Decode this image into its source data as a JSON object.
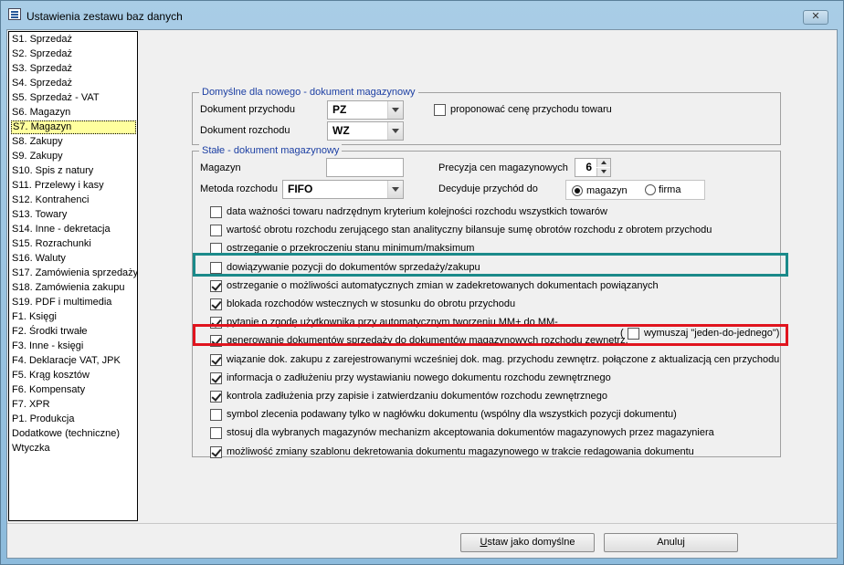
{
  "window": {
    "title": "Ustawienia zestawu baz danych",
    "close_symbol": "✕"
  },
  "nav": {
    "items": [
      {
        "label": "S1. Sprzedaż"
      },
      {
        "label": "S2. Sprzedaż"
      },
      {
        "label": "S3. Sprzedaż"
      },
      {
        "label": "S4. Sprzedaż"
      },
      {
        "label": "S5. Sprzedaż - VAT"
      },
      {
        "label": "S6. Magazyn"
      },
      {
        "label": "S7. Magazyn",
        "selected": true
      },
      {
        "label": "S8. Zakupy"
      },
      {
        "label": "S9. Zakupy"
      },
      {
        "label": "S10. Spis z natury"
      },
      {
        "label": "S11. Przelewy i kasy"
      },
      {
        "label": "S12. Kontrahenci"
      },
      {
        "label": "S13. Towary"
      },
      {
        "label": "S14. Inne - dekretacja"
      },
      {
        "label": "S15. Rozrachunki"
      },
      {
        "label": "S16. Waluty"
      },
      {
        "label": "S17. Zamówienia sprzedaży"
      },
      {
        "label": "S18. Zamówienia zakupu"
      },
      {
        "label": "S19. PDF i multimedia"
      },
      {
        "label": "F1. Księgi"
      },
      {
        "label": "F2. Środki trwałe"
      },
      {
        "label": "F3. Inne - księgi"
      },
      {
        "label": "F4. Deklaracje VAT, JPK"
      },
      {
        "label": "F5. Krąg kosztów"
      },
      {
        "label": "F6. Kompensaty"
      },
      {
        "label": "F7. XPR"
      },
      {
        "label": "P1. Produkcja"
      },
      {
        "label": "Dodatkowe (techniczne)"
      },
      {
        "label": "Wtyczka"
      }
    ]
  },
  "defaults_group": {
    "title": "Domyślne dla nowego - dokument magazynowy",
    "receipt_doc_label": "Dokument przychodu",
    "receipt_doc_value": "PZ",
    "issue_doc_label": "Dokument rozchodu",
    "issue_doc_value": "WZ",
    "propose_price_label": "proponować cenę przychodu towaru",
    "propose_price_checked": false
  },
  "fixed_group": {
    "title": "Stałe - dokument magazynowy",
    "warehouse_label": "Magazyn",
    "warehouse_value": "",
    "price_precision_label": "Precyzja cen magazynowych",
    "price_precision_value": "6",
    "issue_method_label": "Metoda rozchodu",
    "issue_method_value": "FIFO",
    "receipt_decides_label": "Decyduje przychód do",
    "radio_warehouse_label": "magazyn",
    "radio_company_label": "firma",
    "radio_selected": "magazyn",
    "options": [
      {
        "label": "data ważności towaru nadrzędnym kryterium kolejności rozchodu wszystkich towarów",
        "checked": false
      },
      {
        "label": "wartość obrotu rozchodu zerującego stan analityczny bilansuje sumę obrotów rozchodu z obrotem przychodu",
        "checked": false
      },
      {
        "label": "ostrzeganie o przekroczeniu stanu minimum/maksimum",
        "checked": false
      },
      {
        "label": "dowiązywanie pozycji do dokumentów sprzedaży/zakupu",
        "checked": false
      },
      {
        "label": "ostrzeganie o możliwości automatycznych zmian w zadekretowanych dokumentach powiązanych",
        "checked": true
      },
      {
        "label": "blokada rozchodów wstecznych w stosunku do obrotu przychodu",
        "checked": true
      },
      {
        "label": "pytanie o zgodę użytkownika przy automatycznym tworzeniu MM+ do MM-",
        "checked": true
      },
      {
        "label": "generowanie dokumentów sprzedaży do dokumentów magazynowych rozchodu zewnętrz.",
        "checked": true
      },
      {
        "label": "wiązanie dok. zakupu z zarejestrowanymi wcześniej dok. mag. przychodu zewnętrz. połączone z aktualizacją cen przychodu",
        "checked": true
      },
      {
        "label": "informacja o zadłużeniu przy wystawianiu nowego dokumentu rozchodu zewnętrznego",
        "checked": true
      },
      {
        "label": "kontrola zadłużenia przy zapisie i zatwierdzaniu dokumentów rozchodu zewnętrznego",
        "checked": true
      },
      {
        "label": "symbol zlecenia podawany tylko w nagłówku dokumentu (wspólny dla wszystkich pozycji dokumentu)",
        "checked": false
      },
      {
        "label": "stosuj dla wybranych magazynów mechanizm akceptowania dokumentów magazynowych przez magazyniera",
        "checked": false
      },
      {
        "label": "możliwość zmiany szablonu dekretowania dokumentu magazynowego w trakcie redagowania dokumentu",
        "checked": true
      }
    ],
    "one_to_one_open": "(",
    "one_to_one_label": "wymuszaj \"jeden-do-jednego\")",
    "one_to_one_checked": false
  },
  "buttons": {
    "set_default_prefix": "U",
    "set_default_rest": "staw jako domyślne",
    "cancel": "Anuluj"
  },
  "highlights": {
    "teal": "#1b8a8a",
    "red": "#e0141e"
  }
}
